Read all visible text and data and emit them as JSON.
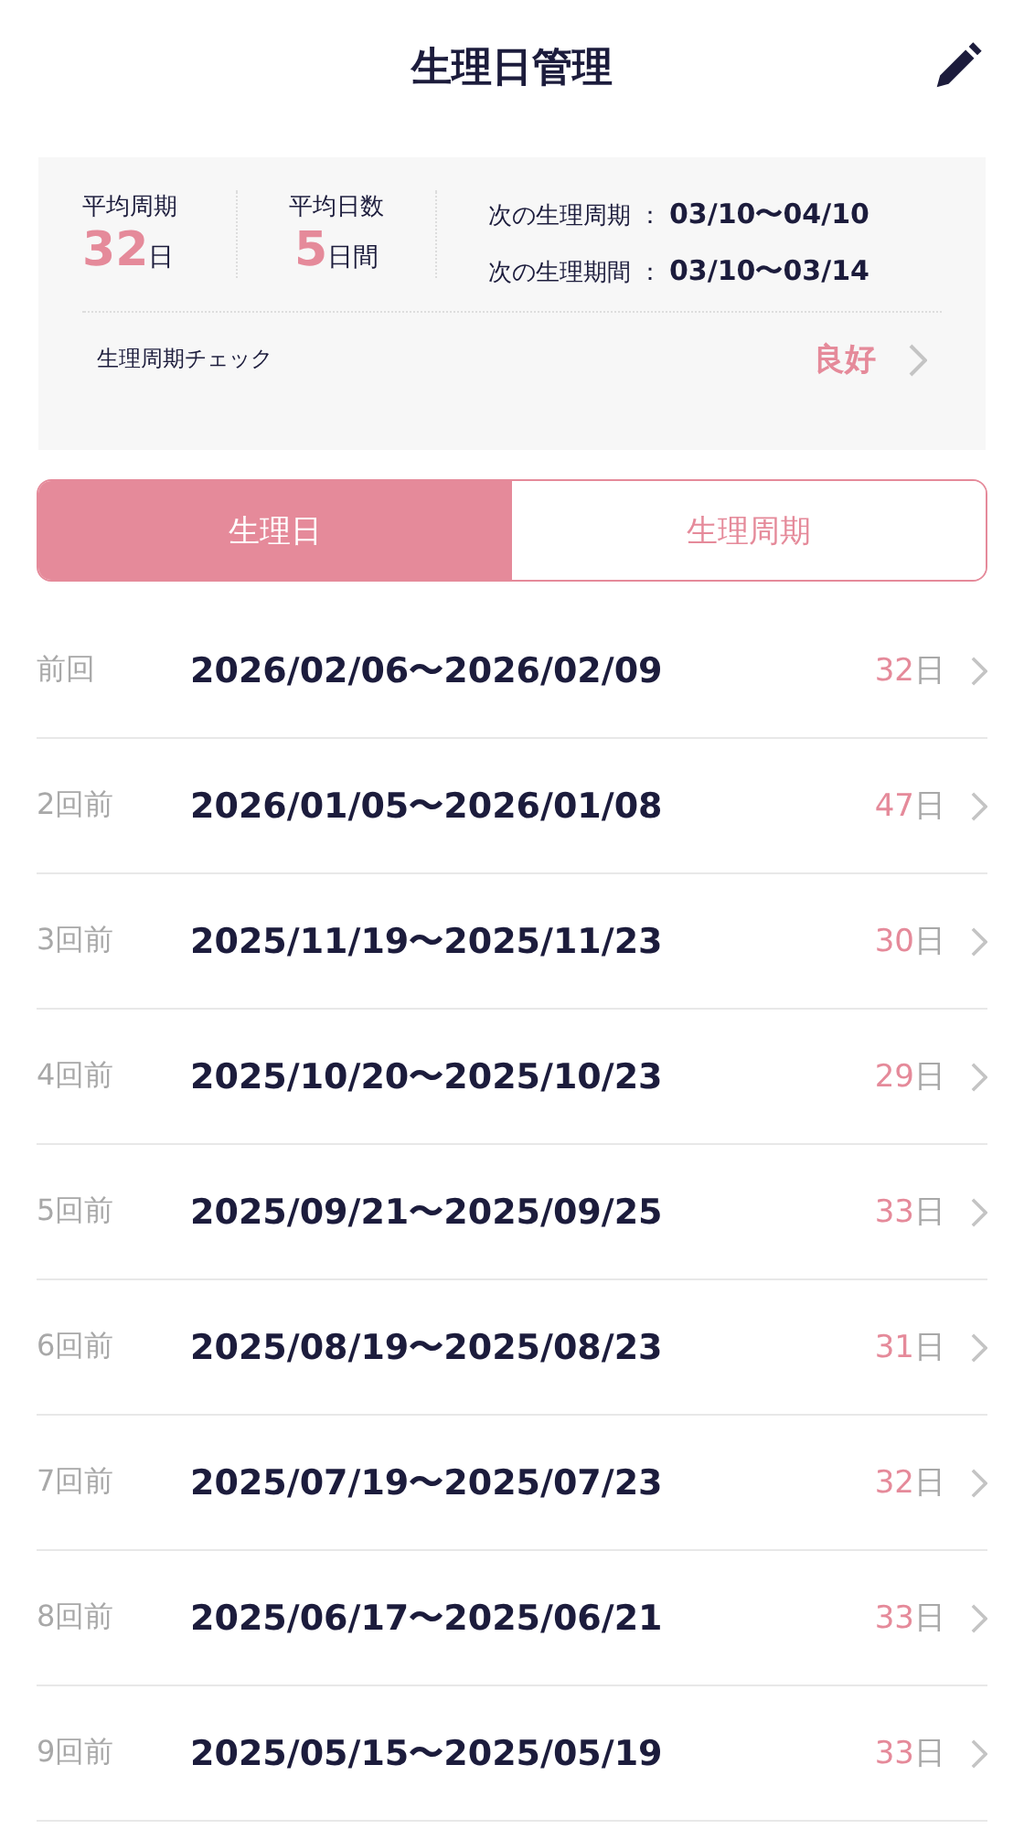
{
  "header": {
    "title": "生理日管理"
  },
  "summary": {
    "stats": [
      {
        "label": "平均周期",
        "value": "32",
        "unit": "日"
      },
      {
        "label": "平均日数",
        "value": "5",
        "unit": "日間"
      }
    ],
    "next": [
      {
        "label": "次の生理周期",
        "separator": "：",
        "value": "03/10〜04/10"
      },
      {
        "label": "次の生理期間",
        "separator": "：",
        "value": "03/10〜03/14"
      }
    ],
    "check": {
      "label": "生理周期チェック",
      "value": "良好"
    }
  },
  "tabs": [
    {
      "label": "生理日",
      "selected": true
    },
    {
      "label": "生理周期",
      "selected": false
    }
  ],
  "records": [
    {
      "label": "前回",
      "range": "2026/02/06〜2026/02/09",
      "days": "32",
      "unit": "日"
    },
    {
      "label": "2回前",
      "range": "2026/01/05〜2026/01/08",
      "days": "47",
      "unit": "日"
    },
    {
      "label": "3回前",
      "range": "2025/11/19〜2025/11/23",
      "days": "30",
      "unit": "日"
    },
    {
      "label": "4回前",
      "range": "2025/10/20〜2025/10/23",
      "days": "29",
      "unit": "日"
    },
    {
      "label": "5回前",
      "range": "2025/09/21〜2025/09/25",
      "days": "33",
      "unit": "日"
    },
    {
      "label": "6回前",
      "range": "2025/08/19〜2025/08/23",
      "days": "31",
      "unit": "日"
    },
    {
      "label": "7回前",
      "range": "2025/07/19〜2025/07/23",
      "days": "32",
      "unit": "日"
    },
    {
      "label": "8回前",
      "range": "2025/06/17〜2025/06/21",
      "days": "33",
      "unit": "日"
    },
    {
      "label": "9回前",
      "range": "2025/05/15〜2025/05/19",
      "days": "33",
      "unit": "日"
    }
  ]
}
